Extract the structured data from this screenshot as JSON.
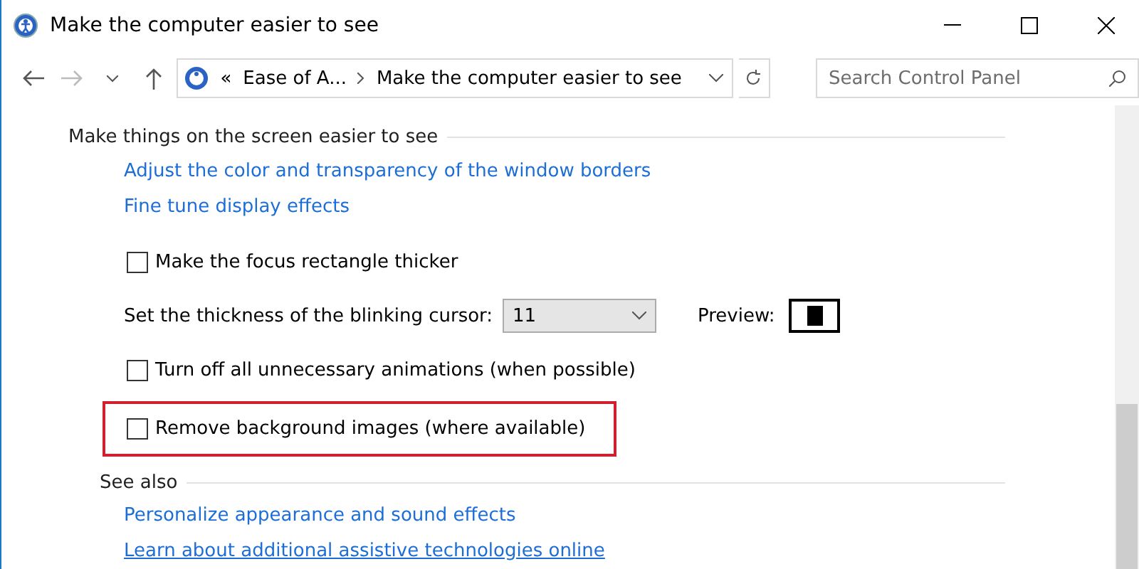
{
  "window": {
    "title": "Make the computer easier to see"
  },
  "address_bar": {
    "overflow": "«",
    "crumbs": [
      "Ease of A...",
      "Make the computer easier to see"
    ]
  },
  "search": {
    "placeholder": "Search Control Panel"
  },
  "section": {
    "heading": "Make things on the screen easier to see",
    "links": [
      "Adjust the color and transparency of the window borders",
      "Fine tune display effects"
    ],
    "items": [
      {
        "kind": "checkbox",
        "label": "Make the focus rectangle thicker",
        "checked": false,
        "highlighted": false
      },
      {
        "kind": "select",
        "label": "Set the thickness of the blinking cursor:",
        "value": "11",
        "preview_label": "Preview:"
      },
      {
        "kind": "checkbox",
        "label": "Turn off all unnecessary animations (when possible)",
        "checked": false,
        "highlighted": false
      },
      {
        "kind": "checkbox",
        "label": "Remove background images (where available)",
        "checked": false,
        "highlighted": true
      }
    ]
  },
  "see_also": {
    "heading": "See also",
    "links": [
      "Personalize appearance and sound effects",
      "Learn about additional assistive technologies online"
    ]
  }
}
